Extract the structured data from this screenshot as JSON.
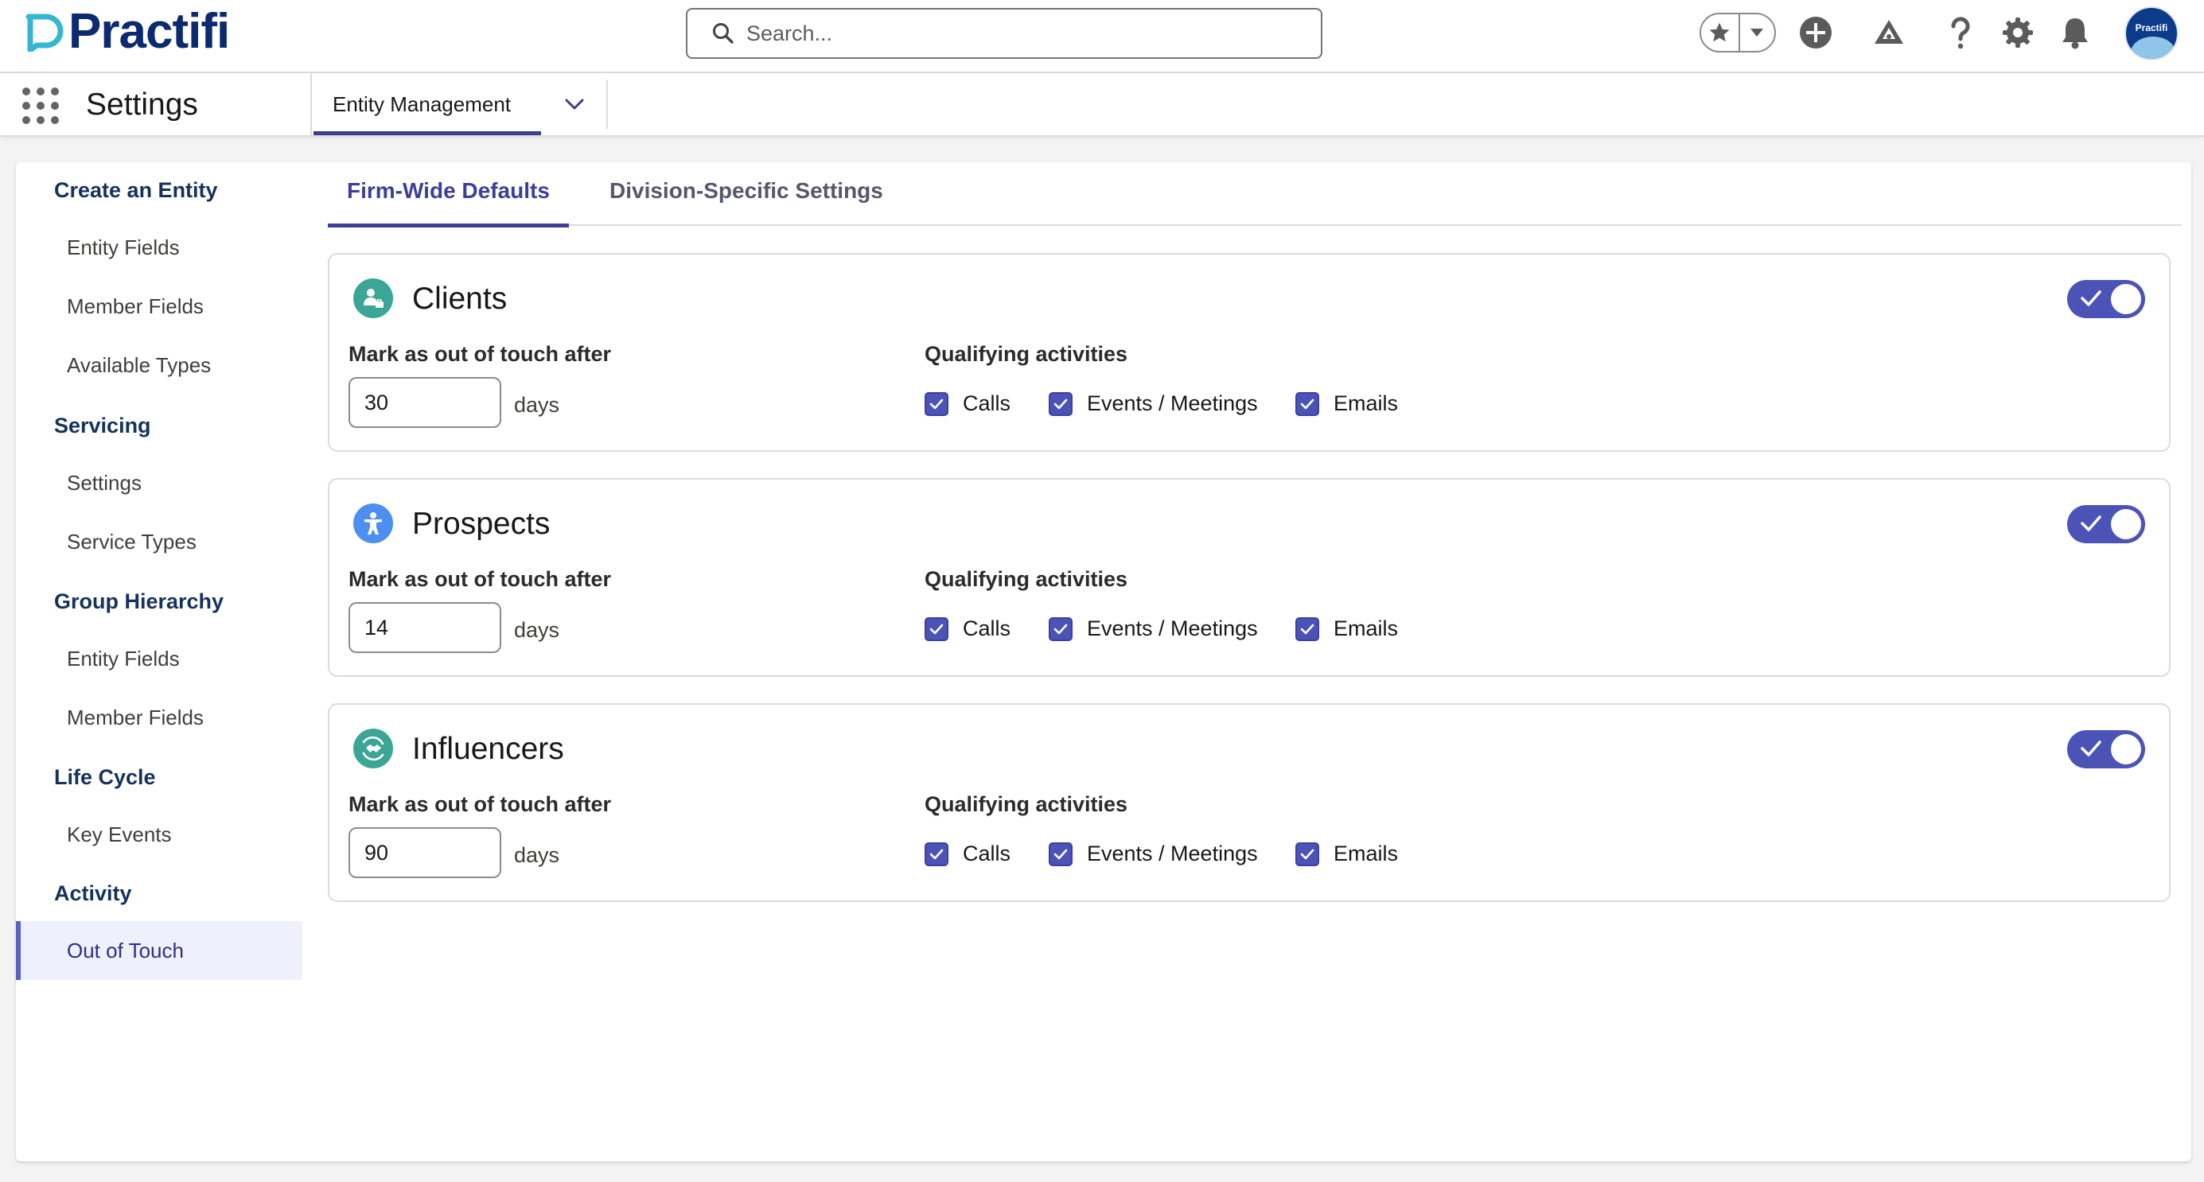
{
  "header": {
    "logo_text": "Practifi",
    "search": {
      "placeholder": "Search..."
    },
    "icons": [
      "star-icon",
      "chevron-down-icon",
      "add-icon",
      "trailhead-icon",
      "help-icon",
      "setup-gear-icon",
      "notification-bell-icon"
    ],
    "avatar_text": "Practifi"
  },
  "navbar": {
    "app_name": "Settings",
    "tab_label": "Entity Management"
  },
  "sidebar": {
    "sections": [
      {
        "heading": "Create an Entity",
        "items": [
          "Entity Fields",
          "Member Fields",
          "Available Types"
        ]
      },
      {
        "heading": "Servicing",
        "items": [
          "Settings",
          "Service Types"
        ]
      },
      {
        "heading": "Group Hierarchy",
        "items": [
          "Entity Fields",
          "Member Fields"
        ]
      },
      {
        "heading": "Life Cycle",
        "items": [
          "Key Events"
        ]
      },
      {
        "heading": "Activity",
        "items": [
          "Out of Touch"
        ]
      }
    ],
    "active_item": "Out of Touch"
  },
  "tabs": [
    {
      "label": "Firm-Wide Defaults",
      "active": true
    },
    {
      "label": "Division-Specific Settings",
      "active": false
    }
  ],
  "cards": [
    {
      "title": "Clients",
      "icon": "client-icon",
      "icon_color": "#3ba696",
      "enabled": true,
      "out_of_touch_label": "Mark as out of touch after",
      "days_value": "30",
      "days_unit": "days",
      "activities_label": "Qualifying activities",
      "activities": [
        {
          "label": "Calls",
          "checked": true
        },
        {
          "label": "Events / Meetings",
          "checked": true
        },
        {
          "label": "Emails",
          "checked": true
        }
      ]
    },
    {
      "title": "Prospects",
      "icon": "prospect-icon",
      "icon_color": "#4d8ff0",
      "enabled": true,
      "out_of_touch_label": "Mark as out of touch after",
      "days_value": "14",
      "days_unit": "days",
      "activities_label": "Qualifying activities",
      "activities": [
        {
          "label": "Calls",
          "checked": true
        },
        {
          "label": "Events / Meetings",
          "checked": true
        },
        {
          "label": "Emails",
          "checked": true
        }
      ]
    },
    {
      "title": "Influencers",
      "icon": "influencer-icon",
      "icon_color": "#3ba696",
      "enabled": true,
      "out_of_touch_label": "Mark as out of touch after",
      "days_value": "90",
      "days_unit": "days",
      "activities_label": "Qualifying activities",
      "activities": [
        {
          "label": "Calls",
          "checked": true
        },
        {
          "label": "Events / Meetings",
          "checked": true
        },
        {
          "label": "Emails",
          "checked": true
        }
      ]
    }
  ],
  "colors": {
    "brand": "#0b2a6f",
    "accent": "#4c53b6",
    "teal": "#3ba696"
  }
}
